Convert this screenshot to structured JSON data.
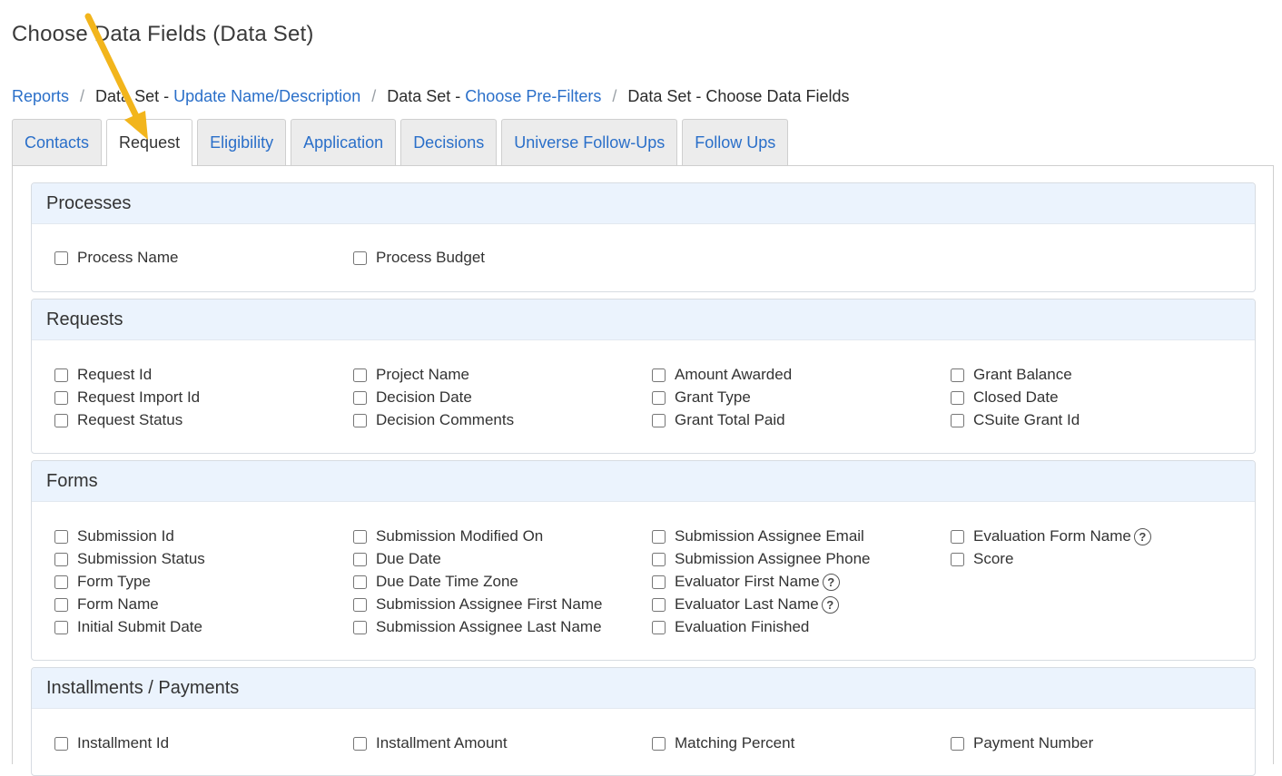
{
  "page_title": "Choose Data Fields (Data Set)",
  "breadcrumb": [
    {
      "link": "Reports"
    },
    {
      "text": "Data Set - ",
      "link": "Update Name/Description"
    },
    {
      "text": "Data Set - ",
      "link": "Choose Pre-Filters"
    },
    {
      "text": "Data Set - Choose Data Fields"
    }
  ],
  "tabs": [
    {
      "label": "Contacts"
    },
    {
      "label": "Request"
    },
    {
      "label": "Eligibility"
    },
    {
      "label": "Application"
    },
    {
      "label": "Decisions"
    },
    {
      "label": "Universe Follow-Ups"
    },
    {
      "label": "Follow Ups"
    }
  ],
  "active_tab": "Request",
  "sections": {
    "processes": {
      "title": "Processes",
      "columns": [
        [
          "Process Name"
        ],
        [
          "Process Budget"
        ]
      ]
    },
    "requests": {
      "title": "Requests",
      "columns": [
        [
          "Request Id",
          "Request Import Id",
          "Request Status"
        ],
        [
          "Project Name",
          "Decision Date",
          "Decision Comments"
        ],
        [
          "Amount Awarded",
          "Grant Type",
          "Grant Total Paid"
        ],
        [
          "Grant Balance",
          "Closed Date",
          "CSuite Grant Id"
        ]
      ]
    },
    "forms": {
      "title": "Forms",
      "columns": [
        [
          "Submission Id",
          "Submission Status",
          "Form Type",
          "Form Name",
          "Initial Submit Date"
        ],
        [
          "Submission Modified On",
          "Due Date",
          "Due Date Time Zone",
          "Submission Assignee First Name",
          "Submission Assignee Last Name"
        ],
        [
          "Submission Assignee Email",
          "Submission Assignee Phone",
          "Evaluator First Name",
          "Evaluator Last Name",
          "Evaluation Finished"
        ],
        [
          "Evaluation Form Name",
          "Score"
        ]
      ]
    },
    "installments": {
      "title": "Installments / Payments",
      "columns": [
        [
          "Installment Id"
        ],
        [
          "Installment Amount"
        ],
        [
          "Matching Percent"
        ],
        [
          "Payment Number"
        ]
      ]
    }
  },
  "help_icon_glyph": "?",
  "colors": {
    "link": "#2a6fc9",
    "panel_header_bg": "#ebf3fd",
    "tab_bg": "#ececec",
    "annotation_arrow": "#f2b51c"
  }
}
